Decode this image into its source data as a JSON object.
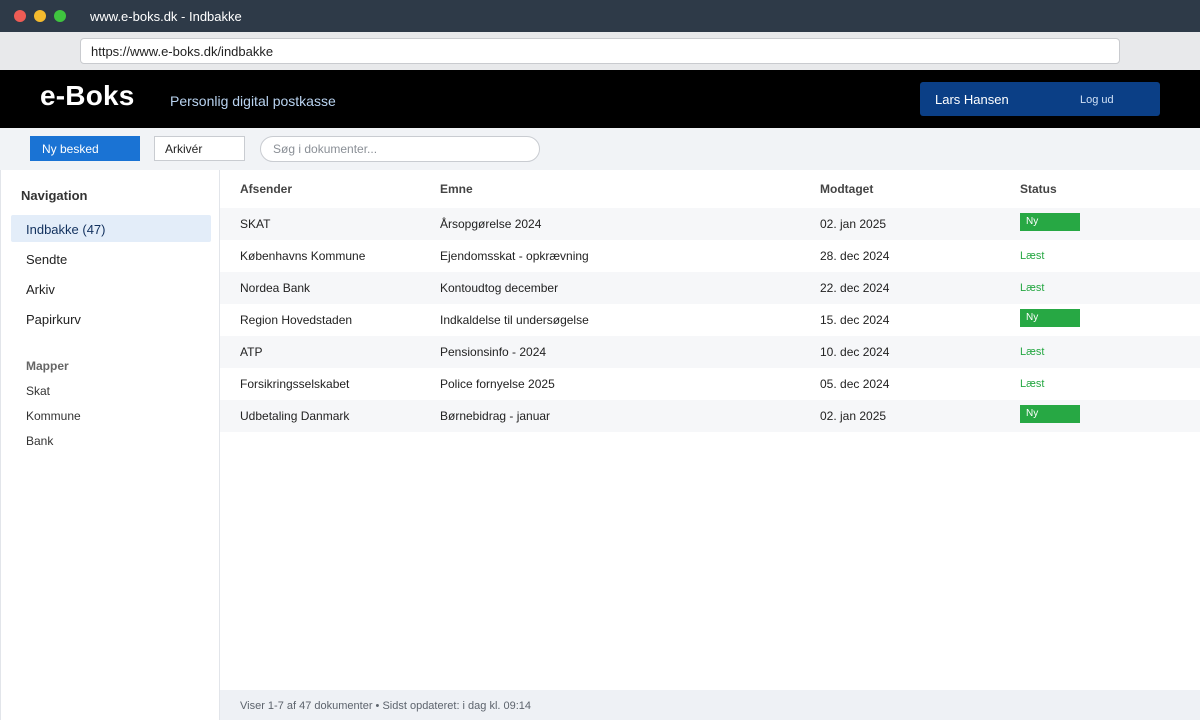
{
  "browser": {
    "window_title": "www.e-boks.dk - Indbakke",
    "url": "https://www.e-boks.dk/indbakke"
  },
  "header": {
    "logo": "e-Boks",
    "tagline": "Personlig digital postkasse",
    "user_name": "Lars Hansen",
    "logout_label": "Log ud"
  },
  "toolbar": {
    "new_message_label": "Ny besked",
    "archive_label": "Arkivér",
    "search_placeholder": "Søg i dokumenter..."
  },
  "sidebar": {
    "heading": "Navigation",
    "items": [
      {
        "label": "Indbakke (47)"
      },
      {
        "label": "Sendte"
      },
      {
        "label": "Arkiv"
      },
      {
        "label": "Papirkurv"
      }
    ],
    "folders_heading": "Mapper",
    "folders": [
      {
        "label": "Skat"
      },
      {
        "label": "Kommune"
      },
      {
        "label": "Bank"
      }
    ]
  },
  "table": {
    "headers": {
      "sender": "Afsender",
      "subject": "Emne",
      "received": "Modtaget",
      "status": "Status"
    },
    "rows": [
      {
        "sender": "SKAT",
        "subject": "Årsopgørelse 2024",
        "received": "02. jan 2025",
        "status": "Ny"
      },
      {
        "sender": "Københavns Kommune",
        "subject": "Ejendomsskat - opkrævning",
        "received": "28. dec 2024",
        "status": "Læst"
      },
      {
        "sender": "Nordea Bank",
        "subject": "Kontoudtog december",
        "received": "22. dec 2024",
        "status": "Læst"
      },
      {
        "sender": "Region Hovedstaden",
        "subject": "Indkaldelse til undersøgelse",
        "received": "15. dec 2024",
        "status": "Ny"
      },
      {
        "sender": "ATP",
        "subject": "Pensionsinfo - 2024",
        "received": "10. dec 2024",
        "status": "Læst"
      },
      {
        "sender": "Forsikringsselskabet",
        "subject": "Police fornyelse 2025",
        "received": "05. dec 2024",
        "status": "Læst"
      },
      {
        "sender": "Udbetaling Danmark",
        "subject": "Børnebidrag - januar",
        "received": "02. jan 2025",
        "status": "Ny"
      }
    ]
  },
  "footer": {
    "text": "Viser 1-7 af 47 dokumenter • Sidst opdateret: i dag kl. 09:14"
  },
  "colors": {
    "header_bg": "#000000",
    "user_panel": "#0b3f86",
    "primary_button": "#1a73d4",
    "status_new": "#27a844",
    "status_read": "#27a844",
    "active_nav": "#e3edf9"
  }
}
